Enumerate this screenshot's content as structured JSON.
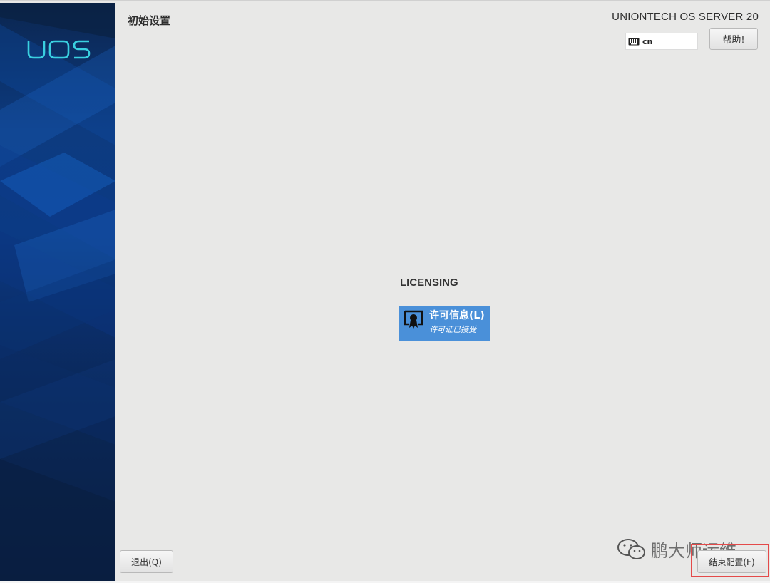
{
  "sidebar": {
    "logo_text": "UOS",
    "logo_color": "#3ad0e0"
  },
  "header": {
    "title": "初始设置",
    "product_name": "UNIONTECH OS SERVER 20",
    "keyboard_layout": "cn",
    "help_label": "帮助!"
  },
  "hub": {
    "category": "LICENSING",
    "spokes": [
      {
        "title": "许可信息(L)",
        "status": "许可证已接受",
        "icon": "license-certificate-icon",
        "color": "#4a90d9"
      }
    ]
  },
  "footer": {
    "quit_label": "退出(Q)",
    "finish_label": "结束配置(F)"
  },
  "watermark": {
    "text": "鹏大师运维",
    "icon": "wechat-icon"
  }
}
